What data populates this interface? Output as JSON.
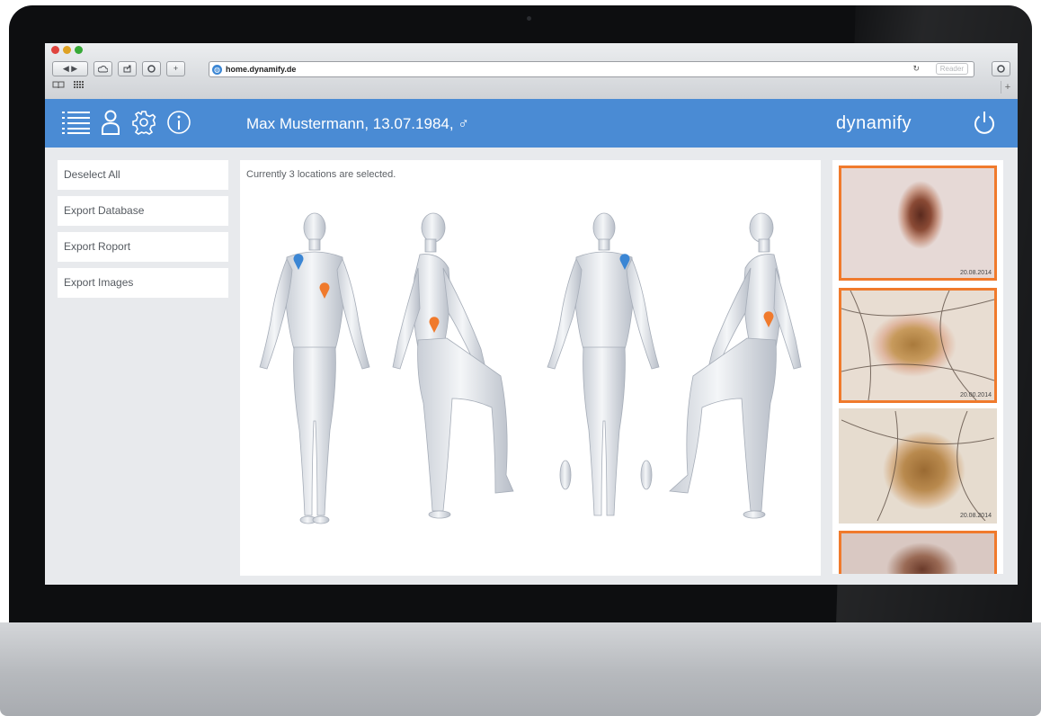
{
  "browser": {
    "url": "home.dynamify.de",
    "reader_label": "Reader",
    "nav_back": "◀",
    "nav_forward": "▶"
  },
  "header": {
    "patient": "Max Mustermann, 13.07.1984, ♂",
    "brand": "dynamify"
  },
  "sidebar": {
    "buttons": [
      {
        "label": "Deselect All"
      },
      {
        "label": "Export Database"
      },
      {
        "label": "Export Roport"
      },
      {
        "label": "Export Images"
      }
    ]
  },
  "main": {
    "status_text": "Currently 3 locations are selected.",
    "views": [
      "front",
      "left side",
      "back",
      "right side"
    ],
    "markers": [
      {
        "view": "front",
        "color": "#3b86d4"
      },
      {
        "view": "front",
        "color": "#f07a2c"
      },
      {
        "view": "left side",
        "color": "#f07a2c"
      },
      {
        "view": "back",
        "color": "#3b86d4"
      },
      {
        "view": "right side",
        "color": "#f07a2c"
      }
    ]
  },
  "images": [
    {
      "date": "20.08.2014",
      "selected": true
    },
    {
      "date": "20.00.2014",
      "selected": true
    },
    {
      "date": "20.08.2014",
      "selected": false
    },
    {
      "date": "",
      "selected": true
    }
  ],
  "colors": {
    "header_blue": "#4a8bd4",
    "selection_orange": "#f07a2c",
    "marker_blue": "#3b86d4"
  },
  "icons": [
    "list-icon",
    "user-icon",
    "gear-icon",
    "info-icon",
    "power-icon"
  ]
}
